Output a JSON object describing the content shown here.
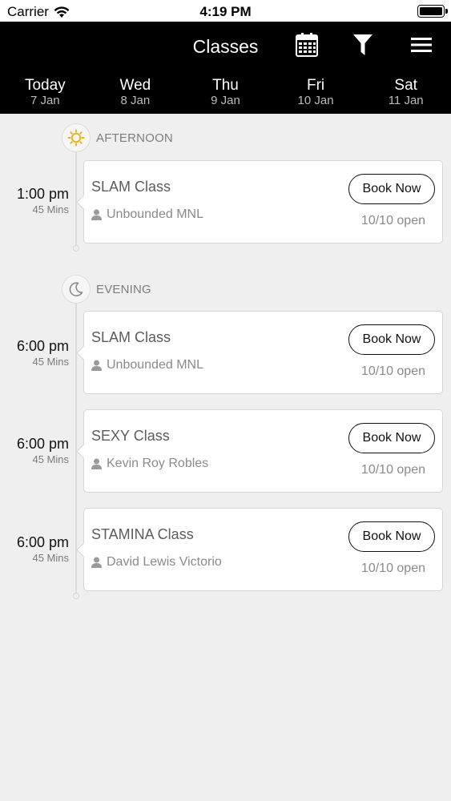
{
  "status_bar": {
    "carrier": "Carrier",
    "time": "4:19 PM"
  },
  "header": {
    "title": "Classes",
    "icons": [
      "calendar-icon",
      "filter-icon",
      "menu-icon"
    ]
  },
  "days": [
    {
      "name": "Today",
      "date": "7 Jan"
    },
    {
      "name": "Wed",
      "date": "8 Jan"
    },
    {
      "name": "Thu",
      "date": "9 Jan"
    },
    {
      "name": "Fri",
      "date": "10 Jan"
    },
    {
      "name": "Sat",
      "date": "11 Jan"
    }
  ],
  "sections": [
    {
      "label": "AFTERNOON",
      "icon": "sun-icon",
      "classes": [
        {
          "time": "1:00 pm",
          "duration": "45 Mins",
          "name": "SLAM Class",
          "instructor": "Unbounded MNL",
          "button": "Book Now",
          "spots": "10/10 open"
        }
      ]
    },
    {
      "label": "EVENING",
      "icon": "moon-icon",
      "classes": [
        {
          "time": "6:00 pm",
          "duration": "45 Mins",
          "name": "SLAM Class",
          "instructor": "Unbounded MNL",
          "button": "Book Now",
          "spots": "10/10 open"
        },
        {
          "time": "6:00 pm",
          "duration": "45 Mins",
          "name": "SEXY Class",
          "instructor": "Kevin Roy Robles",
          "button": "Book Now",
          "spots": "10/10 open"
        },
        {
          "time": "6:00 pm",
          "duration": "45 Mins",
          "name": "STAMINA Class",
          "instructor": "David Lewis Victorio",
          "button": "Book Now",
          "spots": "10/10 open"
        }
      ]
    }
  ],
  "colors": {
    "header_bg": "#000000",
    "page_bg": "#efefef",
    "sun": "#e8b51e"
  }
}
